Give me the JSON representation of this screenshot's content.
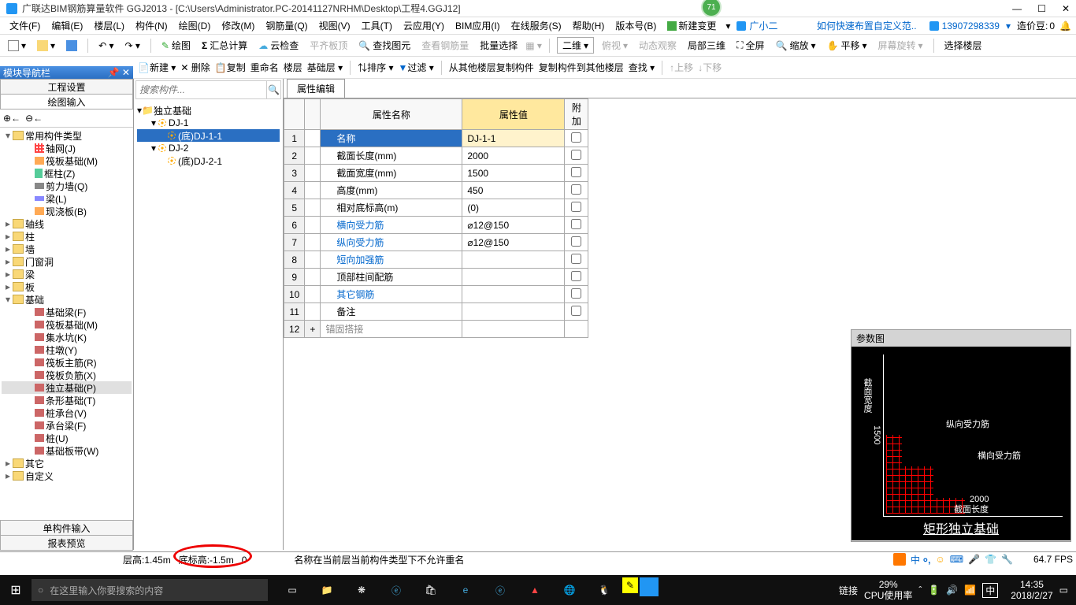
{
  "title": "广联达BIM钢筋算量软件 GGJ2013 - [C:\\Users\\Administrator.PC-20141127NRHM\\Desktop\\工程4.GGJ12]",
  "badge": "71",
  "menubar": {
    "items": [
      "文件(F)",
      "编辑(E)",
      "楼层(L)",
      "构件(N)",
      "绘图(D)",
      "修改(M)",
      "钢筋量(Q)",
      "视图(V)",
      "工具(T)",
      "云应用(Y)",
      "BIM应用(I)",
      "在线服务(S)",
      "帮助(H)",
      "版本号(B)"
    ],
    "newchange": "新建变更",
    "user": "广小二",
    "faq": "如何快速布置自定义范..",
    "phone": "13907298339",
    "credit_label": "造价豆:",
    "credit": "0"
  },
  "toolbar1": {
    "draw": "绘图",
    "sum": "汇总计算",
    "cloud": "云检查",
    "align": "平齐板顶",
    "find": "查找图元",
    "view_rebar": "查看钢筋量",
    "batch": "批量选择",
    "dim2d": "二维",
    "view3d": "俯视",
    "dyn": "动态观察",
    "local3d": "局部三维",
    "full": "全屏",
    "zoom": "缩放",
    "pan": "平移",
    "rot": "屏幕旋转",
    "selfloor": "选择楼层"
  },
  "toolbar2": {
    "new": "新建",
    "del": "删除",
    "copy": "复制",
    "rename": "重命名",
    "floor": "楼层",
    "fnd": "基础层",
    "sort": "排序",
    "filter": "过滤",
    "copyfrom": "从其他楼层复制构件",
    "copyto": "复制构件到其他楼层",
    "find": "查找",
    "up": "上移",
    "down": "下移"
  },
  "nav_panel": {
    "title": "模块导航栏",
    "tabs": {
      "settings": "工程设置",
      "input": "绘图输入"
    },
    "tree": {
      "g0": "常用构件类型",
      "g0_items": [
        {
          "t": "轴网(J)",
          "i": "grid"
        },
        {
          "t": "筏板基础(M)",
          "i": "slab"
        },
        {
          "t": "框柱(Z)",
          "i": "col"
        },
        {
          "t": "剪力墙(Q)",
          "i": "wall"
        },
        {
          "t": "梁(L)",
          "i": "beam"
        },
        {
          "t": "现浇板(B)",
          "i": "slab"
        }
      ],
      "g_axis": "轴线",
      "g_col": "柱",
      "g_wall": "墙",
      "g_door": "门窗洞",
      "g_beam": "梁",
      "g_slab": "板",
      "g_fnd": "基础",
      "fnd_items": [
        {
          "t": "基础梁(F)",
          "i": "fnd"
        },
        {
          "t": "筏板基础(M)",
          "i": "fnd"
        },
        {
          "t": "集水坑(K)",
          "i": "fnd"
        },
        {
          "t": "柱墩(Y)",
          "i": "fnd"
        },
        {
          "t": "筏板主筋(R)",
          "i": "fnd"
        },
        {
          "t": "筏板负筋(X)",
          "i": "fnd"
        },
        {
          "t": "独立基础(P)",
          "i": "fnd",
          "sel": true
        },
        {
          "t": "条形基础(T)",
          "i": "fnd"
        },
        {
          "t": "桩承台(V)",
          "i": "fnd"
        },
        {
          "t": "承台梁(F)",
          "i": "fnd"
        },
        {
          "t": "桩(U)",
          "i": "fnd"
        },
        {
          "t": "基础板带(W)",
          "i": "fnd"
        }
      ],
      "g_other": "其它",
      "g_custom": "自定义"
    },
    "bot_tabs": {
      "single": "单构件输入",
      "report": "报表预览"
    }
  },
  "search_placeholder": "搜索构件...",
  "comp_tree": {
    "root": "独立基础",
    "dj1": "DJ-1",
    "dj1_sub": "(底)DJ-1-1",
    "dj2": "DJ-2",
    "dj2_sub": "(底)DJ-2-1"
  },
  "prop": {
    "tab": "属性编辑",
    "headers": {
      "name": "属性名称",
      "value": "属性值",
      "extra": "附加"
    },
    "rows": [
      {
        "n": "1",
        "name": "名称",
        "val": "DJ-1-1",
        "chk": false,
        "sel": true
      },
      {
        "n": "2",
        "name": "截面长度(mm)",
        "val": "2000",
        "chk": true
      },
      {
        "n": "3",
        "name": "截面宽度(mm)",
        "val": "1500",
        "chk": true
      },
      {
        "n": "4",
        "name": "高度(mm)",
        "val": "450",
        "chk": true
      },
      {
        "n": "5",
        "name": "相对底标高(m)",
        "val": "(0)",
        "chk": true
      },
      {
        "n": "6",
        "name": "横向受力筋",
        "val": "⌀12@150",
        "chk": true,
        "lnk": true
      },
      {
        "n": "7",
        "name": "纵向受力筋",
        "val": "⌀12@150",
        "chk": true,
        "lnk": true
      },
      {
        "n": "8",
        "name": "短向加强筋",
        "val": "",
        "chk": true,
        "lnk": true
      },
      {
        "n": "9",
        "name": "顶部柱间配筋",
        "val": "",
        "chk": true
      },
      {
        "n": "10",
        "name": "其它钢筋",
        "val": "",
        "chk": false,
        "lnk": true
      },
      {
        "n": "11",
        "name": "备注",
        "val": "",
        "chk": true
      },
      {
        "n": "12",
        "name": "锚固搭接",
        "val": "",
        "exp": true
      }
    ]
  },
  "param": {
    "title": "参数图",
    "v_label": "截面宽度",
    "v_val": "1500",
    "h_label": "截面长度",
    "h_val": "2000",
    "r1": "纵向受力筋",
    "r2": "横向受力筋",
    "footer": "矩形独立基础"
  },
  "statusbar": {
    "floor_h_label": "层高:",
    "floor_h": "1.45m",
    "base_label": "底标高:",
    "base": "-1.5m",
    "zero": "0",
    "msg": "名称在当前层当前构件类型下不允许重名",
    "fps": "64.7 FPS"
  },
  "taskbar": {
    "search": "在这里输入你要搜索的内容",
    "link": "链接",
    "cpu_pct": "29%",
    "cpu_lbl": "CPU使用率",
    "ime": "中",
    "time": "14:35",
    "date": "2018/2/27"
  }
}
